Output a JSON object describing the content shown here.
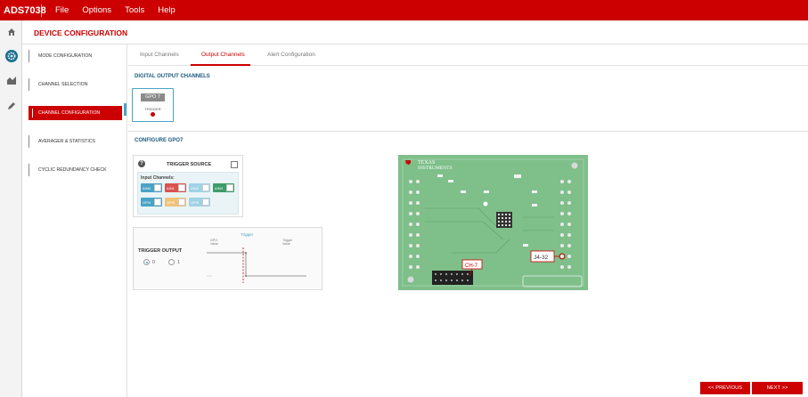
{
  "app": {
    "title": "ADS7038"
  },
  "menu": [
    {
      "label": "File"
    },
    {
      "label": "Options"
    },
    {
      "label": "Tools"
    },
    {
      "label": "Help"
    }
  ],
  "rail": [
    {
      "icon": "home-icon"
    },
    {
      "icon": "gear-icon",
      "active": true
    },
    {
      "icon": "chart-icon"
    },
    {
      "icon": "pencil-icon"
    }
  ],
  "page": {
    "title": "DEVICE CONFIGURATION"
  },
  "steps": [
    {
      "label": "MODE CONFIGURATION"
    },
    {
      "label": "CHANNEL SELECTION"
    },
    {
      "label": "CHANNEL CONFIGURATION",
      "active": true
    },
    {
      "label": "AVERAGER & STATISTICS"
    },
    {
      "label": "CYCLIC REDUNDANCY CHECK"
    }
  ],
  "tabs": [
    {
      "label": "Input Channels"
    },
    {
      "label": "Output Channels",
      "active": true
    },
    {
      "label": "Alert Configuration"
    }
  ],
  "digital_output": {
    "heading": "DIGITAL OUTPUT CHANNELS",
    "gpo_label": "GPO 7",
    "gpo_sub": "TRIGGER"
  },
  "configure": {
    "heading": "CONFIGURE GPO7"
  },
  "trigger_source": {
    "title": "TRIGGER SOURCE",
    "checked": false,
    "input_channels_label": "Input Channels:",
    "chips": [
      {
        "label": "AIN0",
        "color": "#4aa3c4"
      },
      {
        "label": "AIN1",
        "color": "#d9534f"
      },
      {
        "label": "AIN2",
        "color": "#9fd2e4"
      },
      {
        "label": "AIN3",
        "color": "#3e9c6a"
      },
      {
        "label": "GPI4",
        "color": "#4aa3c4"
      },
      {
        "label": "GPI5",
        "color": "#f0c27a"
      },
      {
        "label": "GPI6",
        "color": "#9fd2e4"
      }
    ]
  },
  "trigger_output": {
    "title": "TRIGGER OUTPUT",
    "option_0": "0",
    "option_1": "1",
    "selected": "0",
    "graph_trigger": "Trigger",
    "graph_gpo_value": "GPO\nValue",
    "graph_trigger_value": "Trigger\nValue"
  },
  "board": {
    "brand_line1": "TEXAS",
    "brand_line2": "INSTRUMENTS",
    "callout_ch": "CH-7",
    "callout_j4": "J4-32"
  },
  "footer": {
    "previous_label": "<< PREVIOUS",
    "next_label": "NEXT >>"
  },
  "colors": {
    "brand_red": "#cc0000",
    "accent_blue": "#4aa3c4",
    "heading_blue": "#1a5a7a",
    "board_green": "#7fbf8a"
  }
}
